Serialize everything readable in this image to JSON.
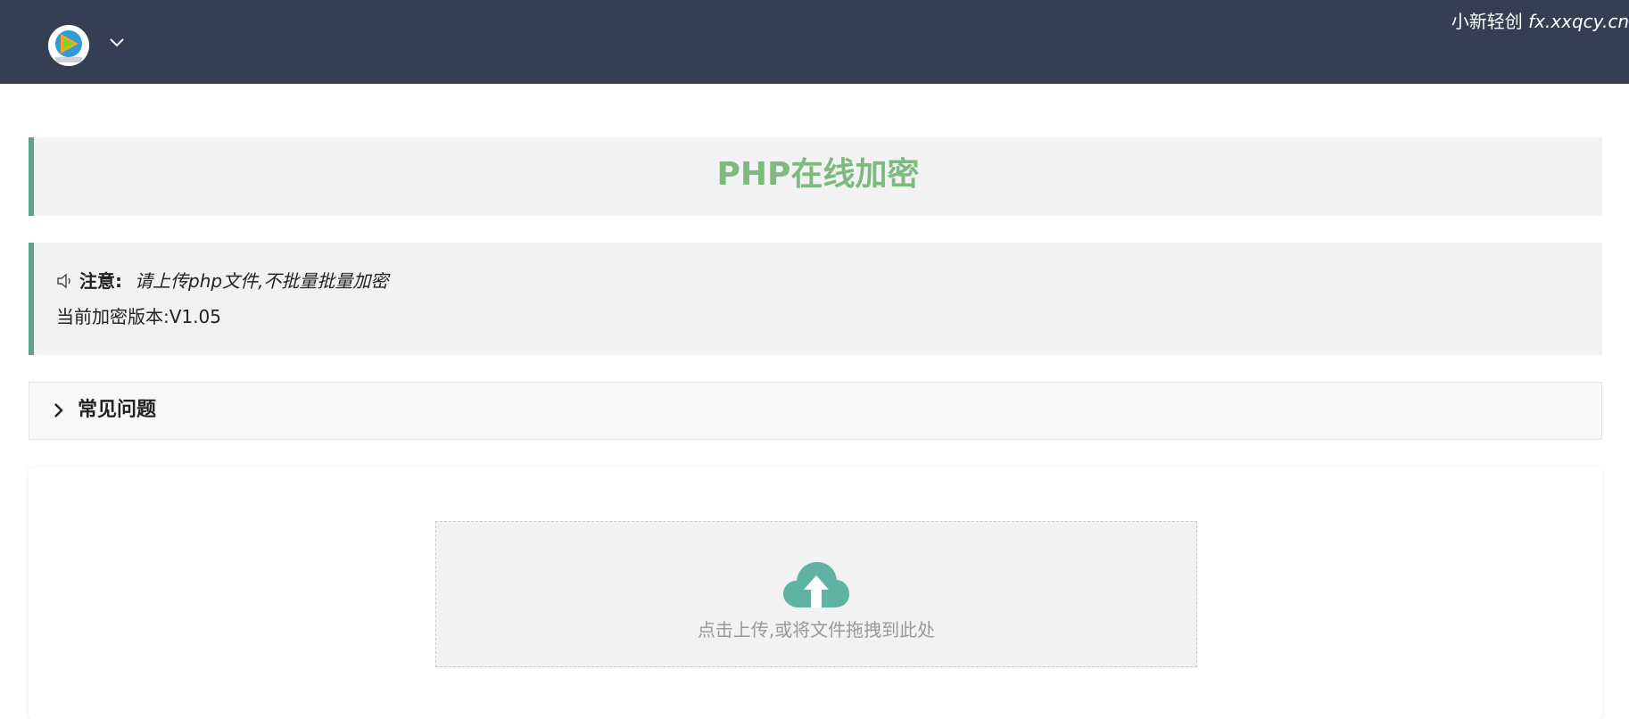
{
  "header": {
    "logo_icon": "video-play-logo-icon",
    "caret_icon": "chevron-down-icon",
    "watermark_cn": "小新轻创",
    "watermark_domain": "fx.xxqcy.cn",
    "bg_color": "#353f53"
  },
  "title": {
    "text": "PHP在线加密",
    "color": "#7cba80",
    "accent_color": "#5fa08f"
  },
  "notice": {
    "icon": "speaker-icon",
    "label": "注意:",
    "text": "请上传php文件,不批量批量加密",
    "version": "当前加密版本:V1.05"
  },
  "faq": {
    "icon": "chevron-right-icon",
    "title": "常见问题"
  },
  "upload": {
    "icon": "cloud-upload-icon",
    "icon_color": "#5fb3a3",
    "text": "点击上传,或将文件拖拽到此处"
  }
}
